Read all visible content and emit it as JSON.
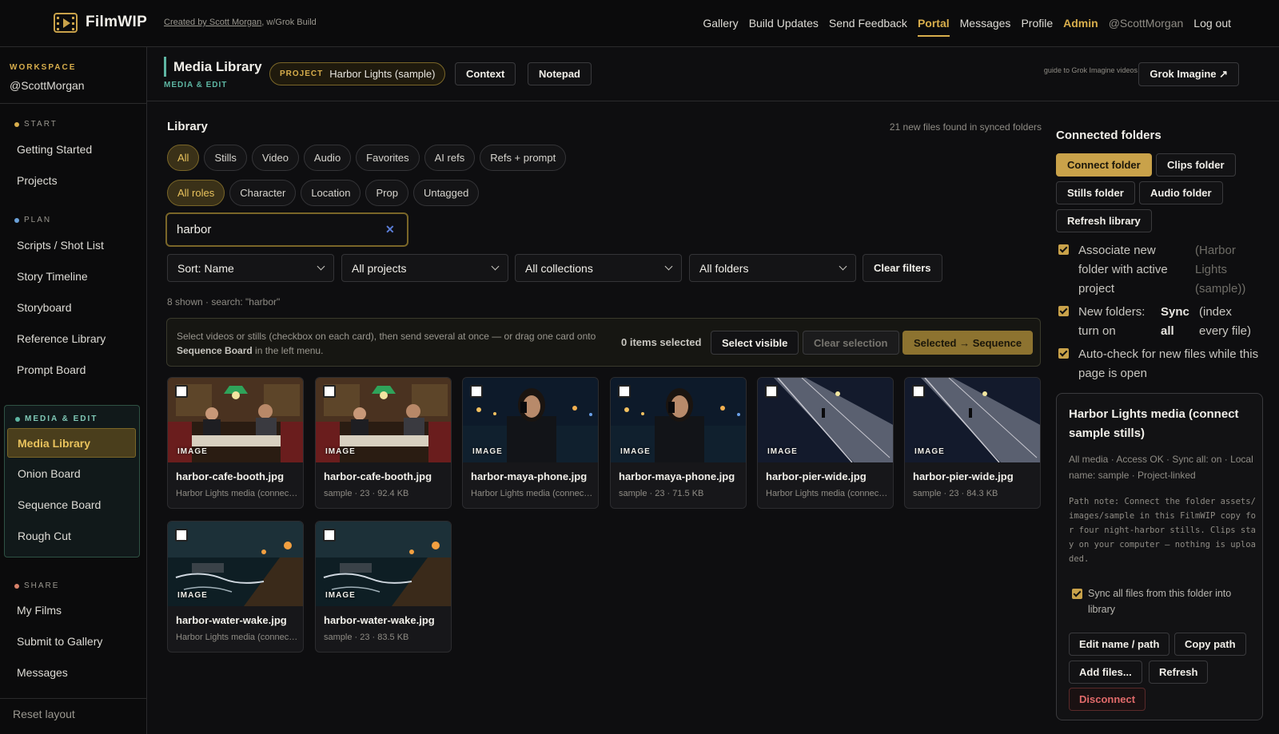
{
  "app": {
    "name": "FilmWIP",
    "credit_link": "Created by Scott Morgan",
    "credit_rest": ", w/Grok Build"
  },
  "nav": {
    "gallery": "Gallery",
    "build_updates": "Build Updates",
    "send_feedback": "Send Feedback",
    "portal": "Portal",
    "messages": "Messages",
    "profile": "Profile",
    "admin": "Admin",
    "handle": "@ScottMorgan",
    "logout": "Log out"
  },
  "sidebar": {
    "workspace_label": "WORKSPACE",
    "workspace_user": "@ScottMorgan",
    "start_label": "START",
    "start_items": [
      "Getting Started",
      "Projects"
    ],
    "plan_label": "PLAN",
    "plan_items": [
      "Scripts / Shot List",
      "Story Timeline",
      "Storyboard",
      "Reference Library",
      "Prompt Board"
    ],
    "media_label": "MEDIA & EDIT",
    "media_items": [
      "Media Library",
      "Onion Board",
      "Sequence Board",
      "Rough Cut"
    ],
    "share_label": "SHARE",
    "share_items": [
      "My Films",
      "Submit to Gallery",
      "Messages"
    ],
    "reset": "Reset layout",
    "colors": {
      "start": "#d8ae4c",
      "plan": "#6aa0d8",
      "media": "#5eb6a3",
      "share": "#d8826a"
    }
  },
  "header": {
    "title": "Media Library",
    "subtitle": "MEDIA & EDIT",
    "project_key": "PROJECT",
    "project_value": "Harbor Lights (sample)",
    "context": "Context",
    "notepad": "Notepad",
    "guide": "guide to Grok Imagine videos",
    "grok": "Grok Imagine ↗"
  },
  "library": {
    "title": "Library",
    "note": "21 new files found in synced folders",
    "type_chips": [
      "All",
      "Stills",
      "Video",
      "Audio",
      "Favorites",
      "AI refs",
      "Refs + prompt"
    ],
    "role_chips": [
      "All roles",
      "Character",
      "Location",
      "Prop",
      "Untagged"
    ],
    "search_value": "harbor",
    "sort": "Sort: Name",
    "projects": "All projects",
    "collections": "All collections",
    "folders": "All folders",
    "clear_filters": "Clear filters",
    "shown": "8 shown · search: \"harbor\"",
    "help_a": "Select videos or stills (checkbox on each card), then send several at once — or drag one card onto ",
    "help_b": "Sequence Board",
    "help_c": " in the left menu.",
    "selected_count": "0 items selected",
    "select_visible": "Select visible",
    "clear_selection": "Clear selection",
    "to_sequence": "Selected → Sequence"
  },
  "cards": [
    {
      "tag": "IMAGE",
      "name": "harbor-cafe-booth.jpg",
      "meta": "Harbor Lights media (connect sample stills)"
    },
    {
      "tag": "IMAGE",
      "name": "harbor-cafe-booth.jpg",
      "meta": "sample · 23 · 92.4 KB"
    },
    {
      "tag": "IMAGE",
      "name": "harbor-maya-phone.jpg",
      "meta": "Harbor Lights media (connect sample stills)"
    },
    {
      "tag": "IMAGE",
      "name": "harbor-maya-phone.jpg",
      "meta": "sample · 23 · 71.5 KB"
    },
    {
      "tag": "IMAGE",
      "name": "harbor-pier-wide.jpg",
      "meta": "Harbor Lights media (connect sample stills)"
    },
    {
      "tag": "IMAGE",
      "name": "harbor-pier-wide.jpg",
      "meta": "sample · 23 · 84.3 KB"
    },
    {
      "tag": "IMAGE",
      "name": "harbor-water-wake.jpg",
      "meta": "Harbor Lights media (connect sample stills)"
    },
    {
      "tag": "IMAGE",
      "name": "harbor-water-wake.jpg",
      "meta": "sample · 23 · 83.5 KB"
    }
  ],
  "right": {
    "title": "Connected folders",
    "connect": "Connect folder",
    "clips": "Clips folder",
    "stills": "Stills folder",
    "audio": "Audio folder",
    "refresh_lib": "Refresh library",
    "opt1_a": "Associate new folder with active project",
    "opt1_b": "(Harbor Lights (sample))",
    "opt2_a": "New folders: turn on",
    "opt2_b": "Sync all",
    "opt2_c": "(index every file)",
    "opt3": "Auto-check for new files while this page is open",
    "box_title": "Harbor Lights media (connect sample stills)",
    "box_status": "All media · Access OK · Sync all: on · Local name: sample · Project-linked",
    "box_path": "Path note: Connect the folder assets/images/sample in this FilmWIP copy for four night-harbor stills. Clips stay on your computer — nothing is uploaded.",
    "box_sync": "Sync all files from this folder into library",
    "edit": "Edit name / path",
    "copy": "Copy path",
    "add": "Add files...",
    "refresh": "Refresh",
    "disconnect": "Disconnect"
  }
}
